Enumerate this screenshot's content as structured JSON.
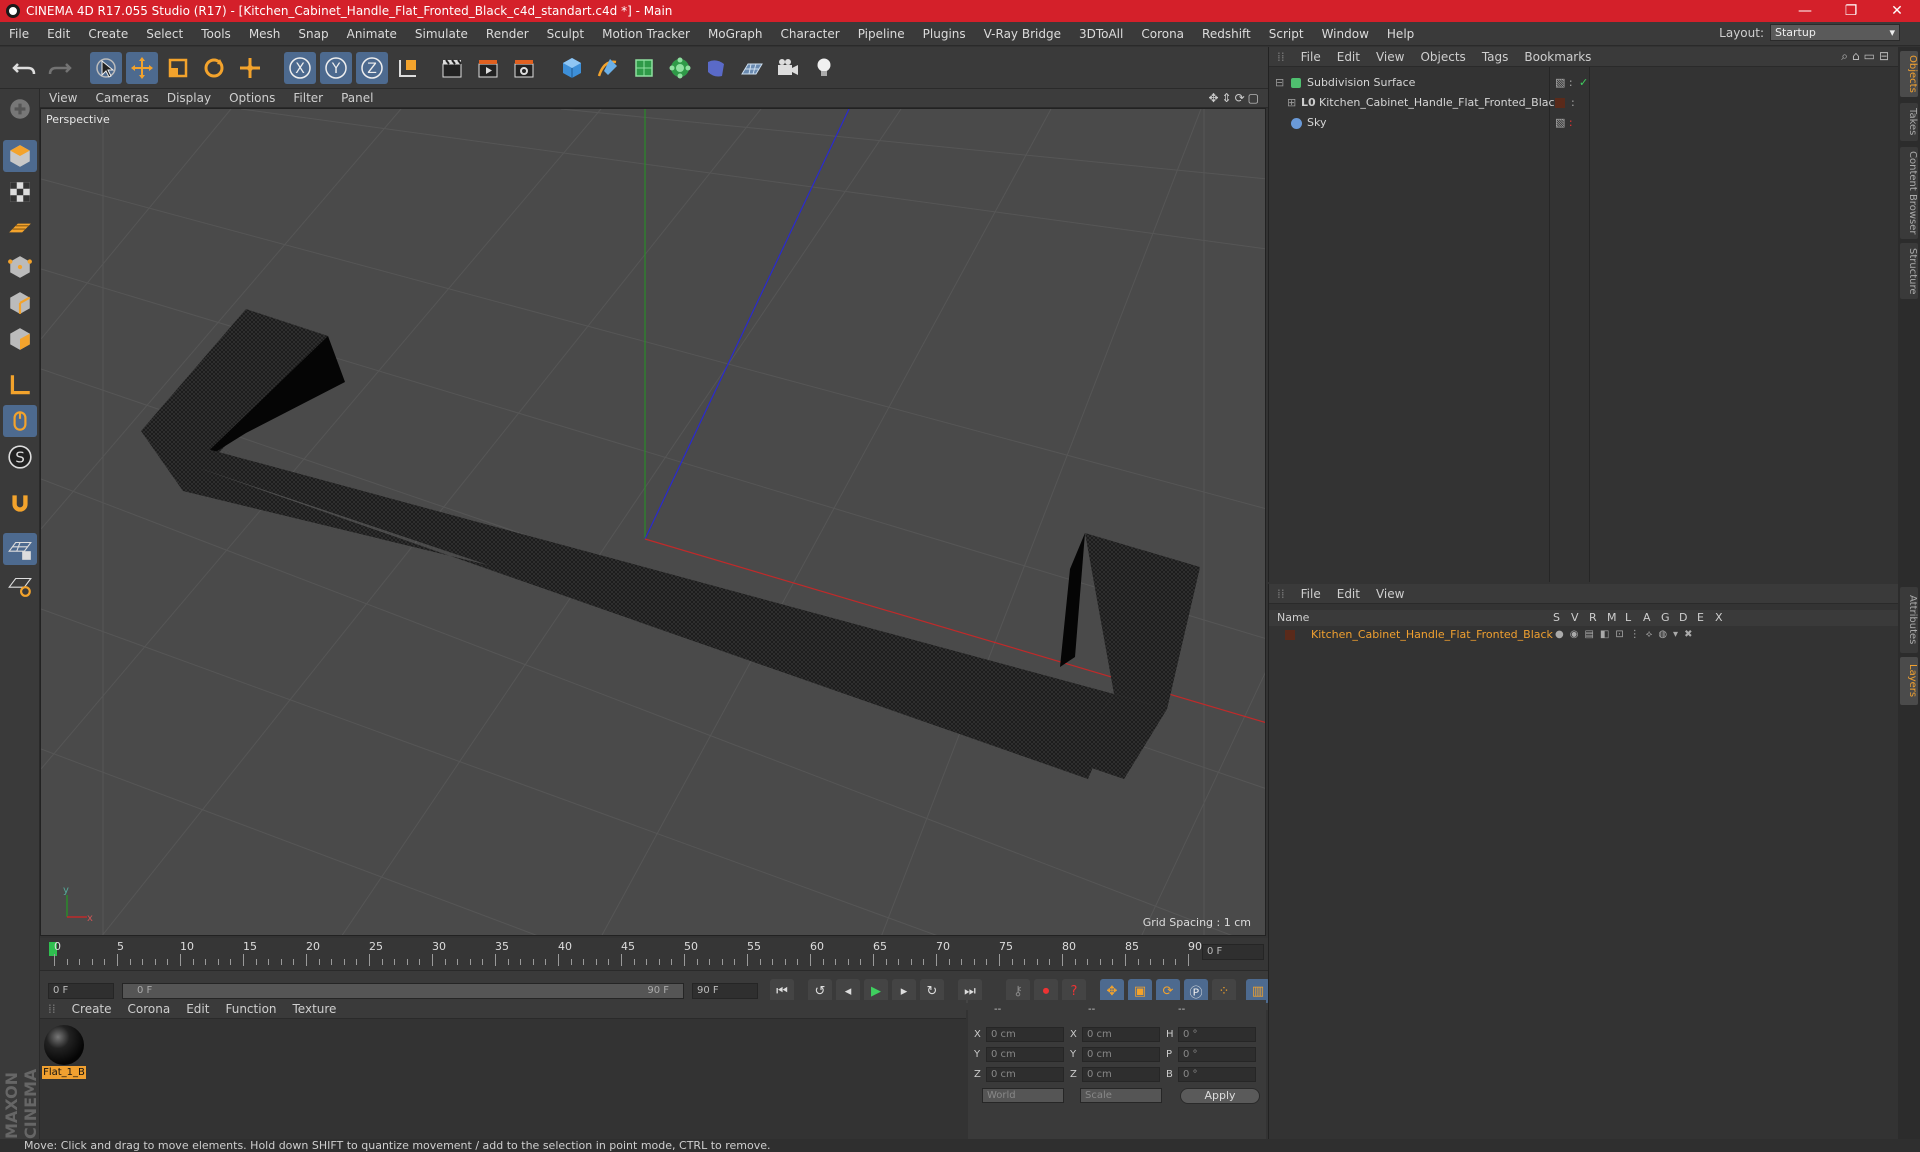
{
  "window": {
    "title": "CINEMA 4D R17.055 Studio (R17) - [Kitchen_Cabinet_Handle_Flat_Fronted_Black_c4d_standart.c4d *] - Main",
    "controls": [
      "—",
      "❐",
      "✕"
    ]
  },
  "menubar": {
    "items": [
      "File",
      "Edit",
      "Create",
      "Select",
      "Tools",
      "Mesh",
      "Snap",
      "Animate",
      "Simulate",
      "Render",
      "Sculpt",
      "Motion Tracker",
      "MoGraph",
      "Character",
      "Pipeline",
      "Plugins",
      "V-Ray Bridge",
      "3DToAll",
      "Corona",
      "Redshift",
      "Script",
      "Window",
      "Help"
    ],
    "layout_label": "Layout:",
    "layout_value": "Startup"
  },
  "viewport": {
    "menu": [
      "View",
      "Cameras",
      "Display",
      "Options",
      "Filter",
      "Panel"
    ],
    "label": "Perspective",
    "grid_spacing": "Grid Spacing : 1 cm"
  },
  "timeline": {
    "ticks": [
      "0",
      "5",
      "10",
      "15",
      "20",
      "25",
      "30",
      "35",
      "40",
      "45",
      "50",
      "55",
      "60",
      "65",
      "70",
      "75",
      "80",
      "85",
      "90"
    ],
    "current_frame": "0 F",
    "start": "0 F",
    "range_start": "0 F",
    "range_end": "90 F",
    "end": "90 F"
  },
  "material_manager": {
    "menu": [
      "Create",
      "Corona",
      "Edit",
      "Function",
      "Texture"
    ],
    "material_name": "Flat_1_B"
  },
  "coordinates": {
    "headers": [
      "--",
      "--",
      "--"
    ],
    "rows": [
      {
        "a": "X",
        "av": "0 cm",
        "b": "X",
        "bv": "0 cm",
        "c": "H",
        "cv": "0 °"
      },
      {
        "a": "Y",
        "av": "0 cm",
        "b": "Y",
        "bv": "0 cm",
        "c": "P",
        "cv": "0 °"
      },
      {
        "a": "Z",
        "av": "0 cm",
        "b": "Z",
        "bv": "0 cm",
        "c": "B",
        "cv": "0 °"
      }
    ],
    "mode1": "World",
    "mode2": "Scale",
    "apply": "Apply"
  },
  "object_manager": {
    "menu": [
      "File",
      "Edit",
      "View",
      "Objects",
      "Tags",
      "Bookmarks"
    ],
    "objects": [
      "Subdivision Surface",
      "Kitchen_Cabinet_Handle_Flat_Fronted_Black",
      "Sky"
    ]
  },
  "layer_manager": {
    "menu": [
      "File",
      "Edit",
      "View"
    ],
    "col_name": "Name",
    "cols": [
      "S",
      "V",
      "R",
      "M",
      "L",
      "A",
      "G",
      "D",
      "E",
      "X"
    ],
    "layer_name": "Kitchen_Cabinet_Handle_Flat_Fronted_Black",
    "layer_color": "#f0a030"
  },
  "side_tabs": [
    "Objects",
    "Takes",
    "Content Browser",
    "Structure",
    "Attributes",
    "Layers"
  ],
  "status": "Move: Click and drag to move elements. Hold down SHIFT to quantize movement / add to the selection in point mode, CTRL to remove.",
  "brand": "MAXON CINEMA 4D",
  "colors": {
    "accent": "#4d6a8f",
    "titlebar": "#d4202a",
    "highlight": "#f0a030"
  }
}
